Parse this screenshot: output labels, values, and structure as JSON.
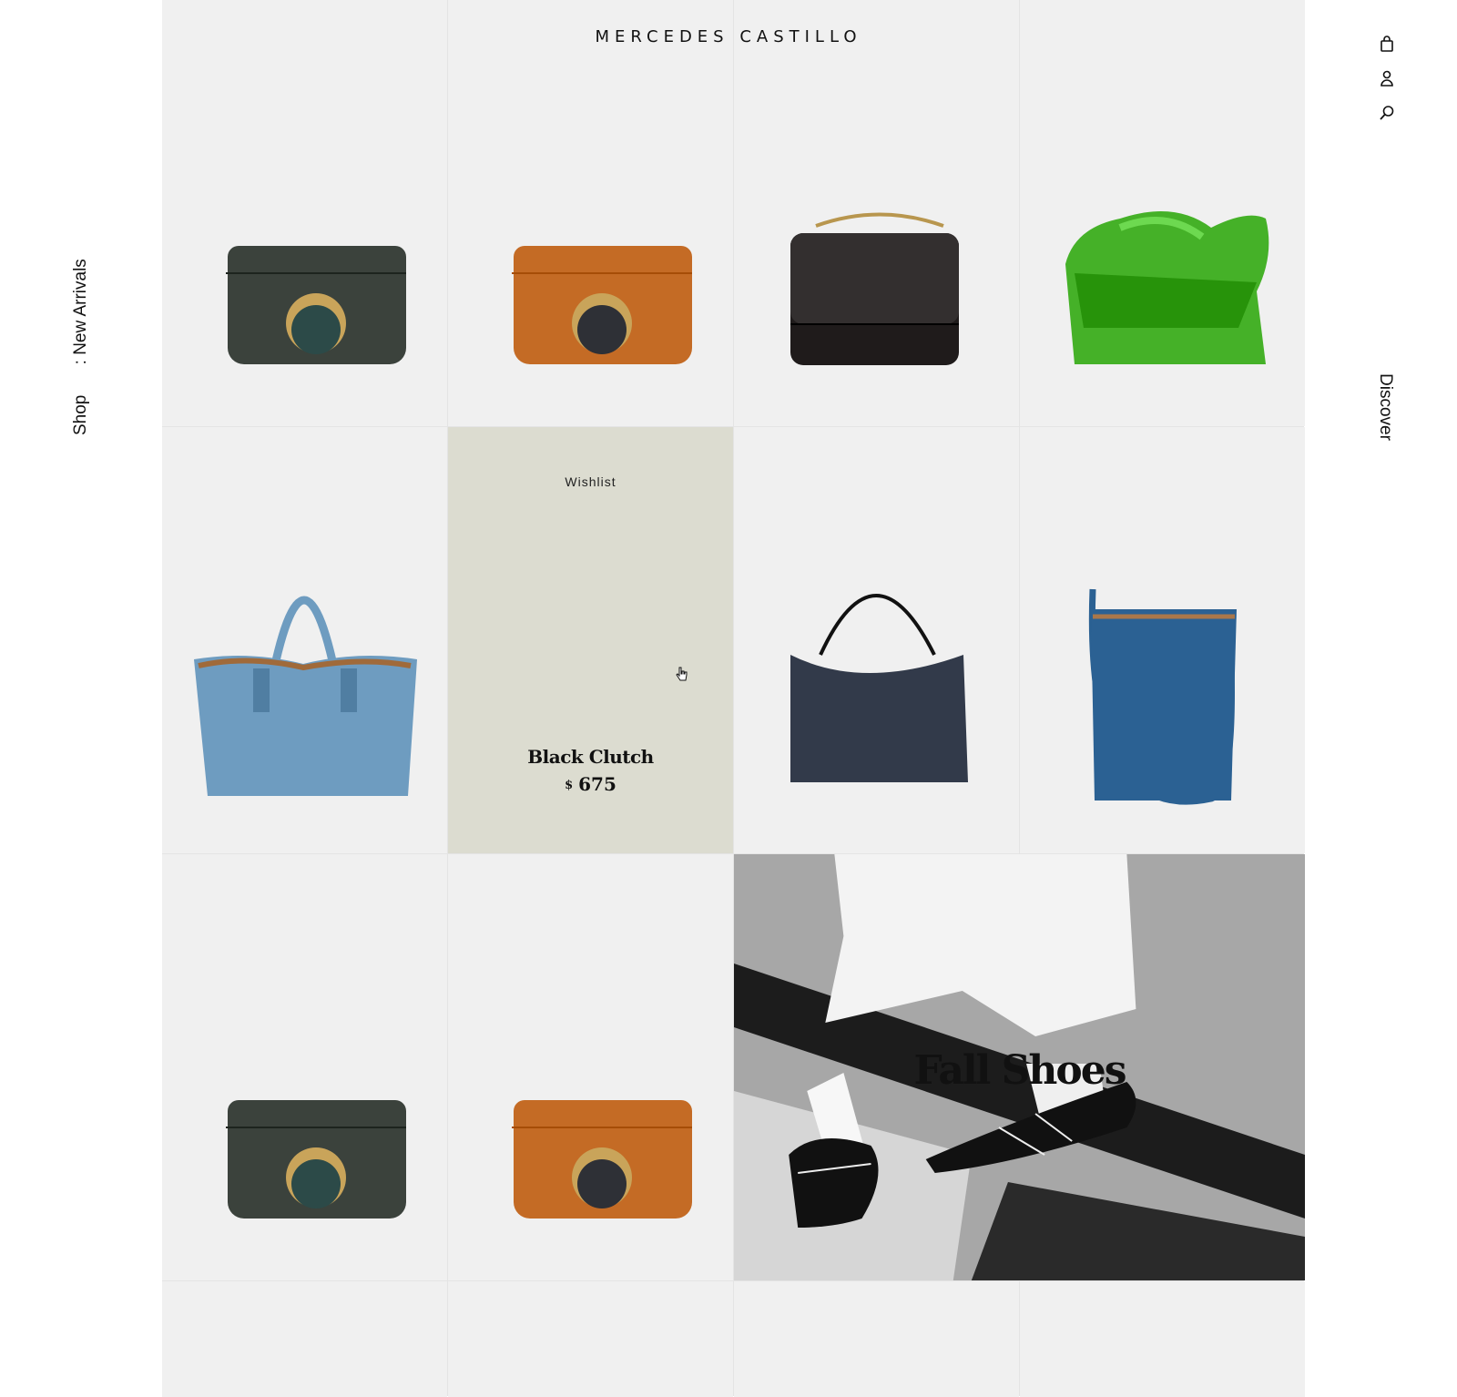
{
  "brand": {
    "name": "MERCEDES CASTILLO"
  },
  "left_nav": {
    "shop": "Shop",
    "new_arrivals": ": New Arrivals"
  },
  "right_nav": {
    "discover": "Discover"
  },
  "header_icons": [
    "bag-icon",
    "account-icon",
    "search-icon"
  ],
  "wishlist": {
    "label": "Wishlist",
    "product_name": "Black Clutch",
    "currency": "$",
    "price": "675"
  },
  "feature": {
    "title": "Fall Shoes"
  },
  "products": [
    {
      "color": "#3b423c",
      "style": "disc-clutch",
      "disc": "#2c4a48"
    },
    {
      "color": "#c46b25",
      "style": "disc-clutch",
      "disc": "#2e3036"
    },
    {
      "color": "#1f1b1b",
      "style": "top-handle"
    },
    {
      "color": "#45b128",
      "style": "knot-bag"
    },
    {
      "color": "#6e9cc0",
      "style": "tote"
    },
    {
      "color": "#323a4a",
      "style": "hobo"
    },
    {
      "color": "#2b6193",
      "style": "crossbody"
    },
    {
      "color": "#3b423c",
      "style": "disc-clutch",
      "disc": "#2c4a48"
    },
    {
      "color": "#c46b25",
      "style": "disc-clutch",
      "disc": "#2e3036"
    }
  ]
}
